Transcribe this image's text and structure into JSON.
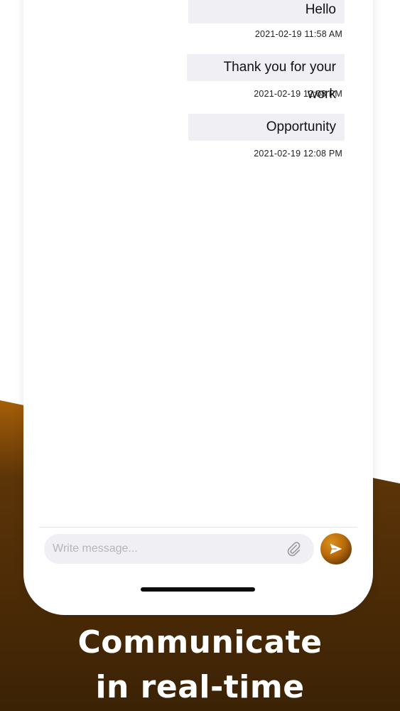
{
  "chat": {
    "messages": [
      {
        "text": "Hello",
        "timestamp": "2021-02-19 11:58 AM"
      },
      {
        "text": "Thank you for your work",
        "timestamp": "2021-02-19 12:08 PM"
      },
      {
        "text": "Opportunity",
        "timestamp": "2021-02-19 12:08 PM"
      }
    ]
  },
  "composer": {
    "placeholder": "Write message...",
    "attach_icon": "paperclip-icon",
    "send_icon": "send-icon"
  },
  "caption": {
    "line1": "Communicate",
    "line2": "in real-time"
  },
  "colors": {
    "accent": "#b96a0a",
    "background_dark": "#3a2208",
    "bubble": "#efeff4"
  }
}
